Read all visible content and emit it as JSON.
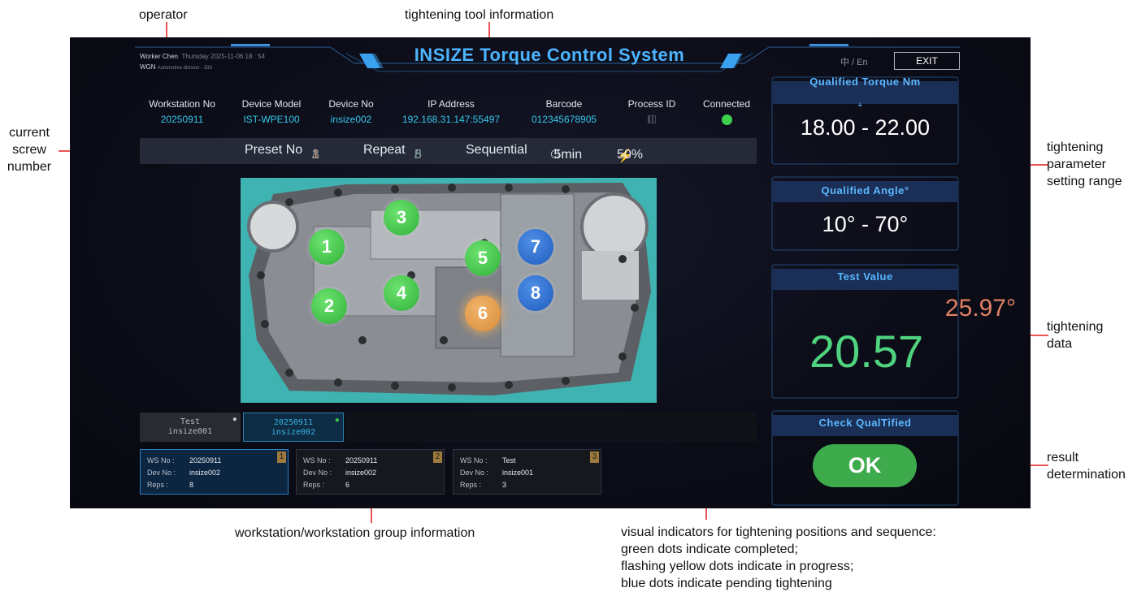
{
  "annotations": {
    "operator": "operator",
    "tool_info": "tightening tool information",
    "current_screw": [
      "current",
      "screw",
      "number"
    ],
    "param_range": [
      "tightening",
      "parameter",
      "setting range"
    ],
    "tightening_data": [
      "tightening",
      "data"
    ],
    "result": [
      "result",
      "determination"
    ],
    "workstation_group": "workstation/workstation group information",
    "indicators": [
      "visual indicators for tightening positions and sequence:",
      "green dots indicate completed;",
      "flashing yellow dots indicate in progress;",
      "blue dots indicate pending tightening"
    ]
  },
  "header": {
    "worker": "Worker Chen",
    "datetime": "Thursday 2025-11-06 18 : 54",
    "group": "WGN",
    "division": "Automotive division - 333",
    "title": "INSIZE Torque Control System",
    "lang": "中 / En",
    "exit_label": "EXIT"
  },
  "device_info": [
    {
      "label": "Workstation No",
      "value": "20250911"
    },
    {
      "label": "Device Model",
      "value": "IST-WPE100"
    },
    {
      "label": "Device No",
      "value": "insize002"
    },
    {
      "label": "IP Address",
      "value": "192.168.31.147:55497"
    },
    {
      "label": "Barcode",
      "value": "012345678905"
    },
    {
      "label": "Process ID",
      "value": ""
    },
    {
      "label": "Connected",
      "value": ""
    }
  ],
  "preset": {
    "label": "Preset No",
    "current": "1",
    "total": "3",
    "repeat_label": "Repeat",
    "repeat_current": "5",
    "repeat_total": "8",
    "mode": "Sequential",
    "timer": "5min",
    "power": "50%"
  },
  "screws": [
    {
      "n": "1",
      "status": "completed"
    },
    {
      "n": "2",
      "status": "completed"
    },
    {
      "n": "3",
      "status": "completed"
    },
    {
      "n": "4",
      "status": "completed"
    },
    {
      "n": "5",
      "status": "completed"
    },
    {
      "n": "6",
      "status": "in-progress"
    },
    {
      "n": "7",
      "status": "pending"
    },
    {
      "n": "8",
      "status": "pending"
    }
  ],
  "tabs": [
    {
      "line1": "Test",
      "line2": "insize001"
    },
    {
      "line1": "20250911",
      "line2": "insize002"
    }
  ],
  "ws_cards": [
    {
      "index": "1",
      "ws_label": "WS No :",
      "ws": "20250911",
      "dev_label": "Dev No :",
      "dev": "insize002",
      "reps_label": "Reps :",
      "reps": "8"
    },
    {
      "index": "2",
      "ws_label": "WS No :",
      "ws": "20250911",
      "dev_label": "Dev No :",
      "dev": "insize002",
      "reps_label": "Reps :",
      "reps": "6"
    },
    {
      "index": "3",
      "ws_label": "WS No :",
      "ws": "Test",
      "dev_label": "Dev No :",
      "dev": "insize001",
      "reps_label": "Reps :",
      "reps": "3"
    }
  ],
  "panels": {
    "torque": {
      "title": "Qualified Torque Nm",
      "range": "18.00 - 22.00"
    },
    "angle": {
      "title": "Qualified Angle°",
      "range": "10° - 70°"
    },
    "test": {
      "title": "Test Value",
      "angle": "25.97°",
      "torque": "20.57"
    },
    "check": {
      "title": "Check QualTified",
      "result": "OK"
    }
  },
  "colors": {
    "completed": "#3fbf4c",
    "in_progress": "#e09b4a",
    "pending": "#2a6fd1",
    "accent": "#4db4ff",
    "value_cyan": "#36c6ea",
    "annotation_red": "#e21b1b"
  },
  "icons": {
    "timer": "stopwatch-icon",
    "power": "lightning-icon",
    "process": "qr-code-icon",
    "connected": "status-dot-icon"
  }
}
